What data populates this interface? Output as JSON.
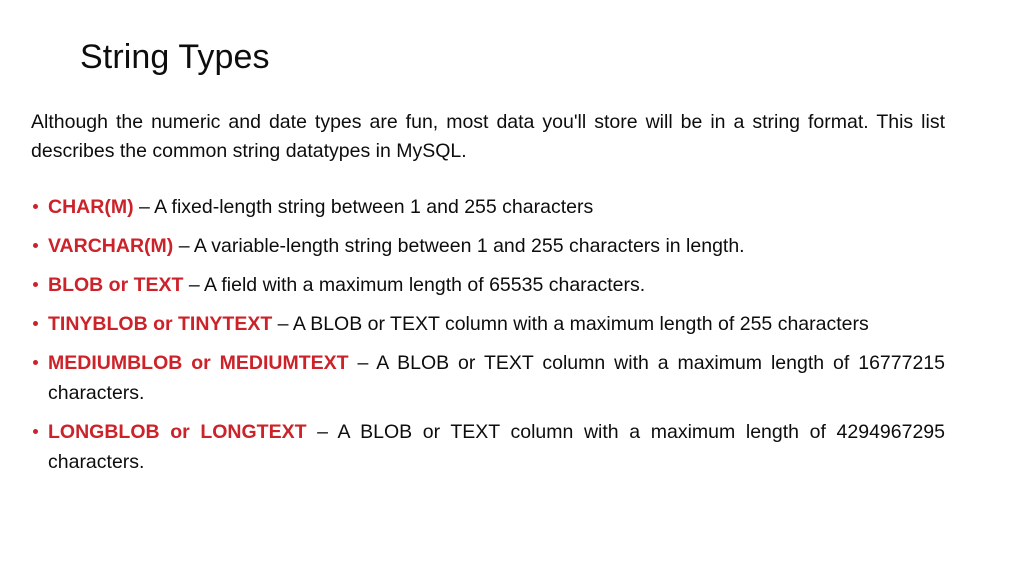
{
  "slide": {
    "title": "String Types",
    "background_color": "#ffffff",
    "accent_color": "#cc2229",
    "text_color": "#0d0d0d",
    "intro_paragraph": "Although the numeric and date types are fun, most data you'll store will be in a string format. This list describes the common string datatypes in MySQL.",
    "bullet_marker": "bullet-dot"
  },
  "bullets": [
    {
      "term": "CHAR(M)",
      "dash": " – ",
      "description": "A fixed-length string between 1 and 255 characters"
    },
    {
      "term": "VARCHAR(M)",
      "dash": " – ",
      "description": "A variable-length string between 1 and 255 characters in length."
    },
    {
      "term": "BLOB or TEXT",
      "dash": " – ",
      "description": "A field with a maximum length of 65535 characters."
    },
    {
      "term": "TINYBLOB or TINYTEXT",
      "dash": " – ",
      "description": "A BLOB or TEXT column with a maximum length of 255 characters"
    },
    {
      "term": "MEDIUMBLOB or MEDIUMTEXT",
      "dash": " – ",
      "description": "A BLOB or TEXT column with a maximum length of 16777215 characters."
    },
    {
      "term": "LONGBLOB or LONGTEXT",
      "dash": " – ",
      "description": "A BLOB or TEXT column with a maximum length of 4294967295 characters."
    }
  ]
}
